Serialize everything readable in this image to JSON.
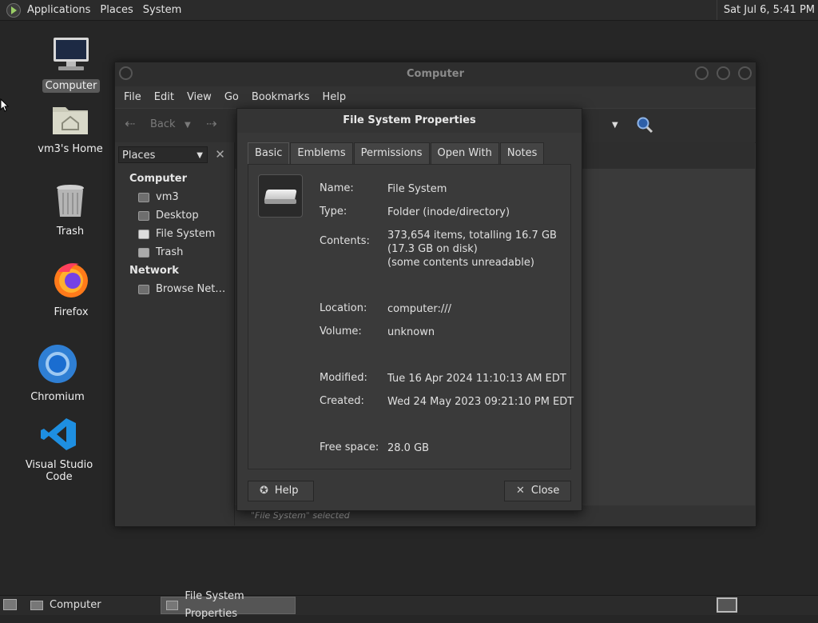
{
  "top_panel": {
    "menus": [
      "Applications",
      "Places",
      "System"
    ],
    "clock": "Sat Jul  6,  5:41 PM"
  },
  "desktop": {
    "icons": [
      {
        "label": "Computer",
        "icon": "computer-icon"
      },
      {
        "label": "vm3's Home",
        "icon": "home-folder-icon"
      },
      {
        "label": "Trash",
        "icon": "trash-icon"
      },
      {
        "label": "Firefox",
        "icon": "firefox-icon"
      },
      {
        "label": "Chromium",
        "icon": "chromium-icon"
      },
      {
        "label": "Visual Studio Code",
        "icon": "vscode-icon"
      }
    ]
  },
  "window": {
    "title": "Computer",
    "menu": [
      "File",
      "Edit",
      "View",
      "Go",
      "Bookmarks",
      "Help"
    ],
    "toolbar": {
      "back_label": "Back"
    },
    "sidebar": {
      "combo": "Places",
      "sections": [
        {
          "heading": "Computer",
          "items": [
            "vm3",
            "Desktop",
            "File System",
            "Trash"
          ]
        },
        {
          "heading": "Network",
          "items": [
            "Browse Net…"
          ]
        }
      ]
    },
    "status": "\"File System\" selected"
  },
  "dialog": {
    "title": "File System Properties",
    "tabs": [
      "Basic",
      "Emblems",
      "Permissions",
      "Open With",
      "Notes"
    ],
    "properties": {
      "name": {
        "key": "Name:",
        "value": "File System"
      },
      "type": {
        "key": "Type:",
        "value": "Folder (inode/directory)"
      },
      "contents": {
        "key": "Contents:",
        "value": "373,654 items, totalling 16.7 GB\n(17.3 GB on disk)\n(some contents unreadable)"
      },
      "location": {
        "key": "Location:",
        "value": "computer:///"
      },
      "volume": {
        "key": "Volume:",
        "value": "unknown"
      },
      "modified": {
        "key": "Modified:",
        "value": "Tue 16 Apr 2024 11:10:13 AM EDT"
      },
      "created": {
        "key": "Created:",
        "value": "Wed 24 May 2023 09:21:10 PM EDT"
      },
      "free_space": {
        "key": "Free space:",
        "value": "28.0 GB"
      }
    },
    "help_label": "Help",
    "close_label": "Close"
  },
  "taskbar": {
    "tasks": [
      "Computer",
      "File System Properties"
    ]
  },
  "colors": {
    "background": "#262626",
    "panel": "#2b2b2b",
    "dialog": "#383838"
  }
}
